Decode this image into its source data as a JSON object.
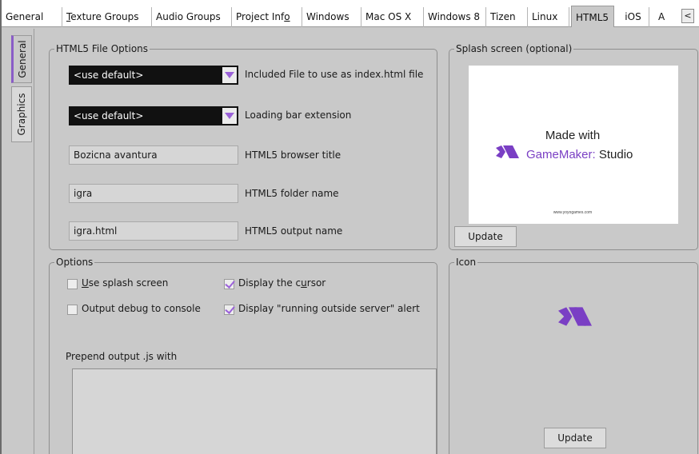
{
  "tabs": [
    {
      "pre": "",
      "ul": "",
      "label": "General"
    },
    {
      "pre": "",
      "ul": "T",
      "label": "exture Groups"
    },
    {
      "pre": "",
      "ul": "",
      "label": "Audio Groups"
    },
    {
      "pre": "Project Inf",
      "ul": "o",
      "label": ""
    },
    {
      "pre": "",
      "ul": "",
      "label": "Windows"
    },
    {
      "pre": "",
      "ul": "",
      "label": "Mac OS X"
    },
    {
      "pre": "",
      "ul": "",
      "label": "Windows 8"
    },
    {
      "pre": "",
      "ul": "",
      "label": "Tizen"
    },
    {
      "pre": "",
      "ul": "",
      "label": "Linux"
    },
    {
      "pre": "",
      "ul": "",
      "label": "HTML5"
    },
    {
      "pre": "",
      "ul": "",
      "label": "iOS"
    },
    {
      "pre": "",
      "ul": "",
      "label": "A"
    }
  ],
  "tab_scroll_glyph": "<",
  "side_tabs": [
    "General",
    "Graphics"
  ],
  "html5_options": {
    "legend": "HTML5 File Options",
    "index_dropdown_value": "<use default>",
    "index_label": "Included File to use as index.html file",
    "loadingbar_dropdown_value": "<use default>",
    "loadingbar_label": "Loading bar extension",
    "browser_title_value": "Bozicna avantura",
    "browser_title_label": "HTML5 browser title",
    "folder_name_value": "igra",
    "folder_name_label": "HTML5 folder name",
    "output_name_value": "igra.html",
    "output_name_label": "HTML5 output name"
  },
  "splash": {
    "legend": "Splash screen (optional)",
    "made_with": "Made with",
    "brand": "GameMaker: Studio",
    "url": "www.yoyogames.com",
    "update_label": "Update"
  },
  "options": {
    "legend": "Options",
    "use_splash": {
      "ul": "U",
      "label": "se splash screen",
      "checked": false
    },
    "debug_console": {
      "label": "Output debug to console",
      "checked": false
    },
    "display_cursor": {
      "pre": "Display the c",
      "ul": "u",
      "label": "rsor",
      "checked": true
    },
    "server_alert": {
      "label": "Display \"running outside server\" alert",
      "checked": true
    },
    "prepend_label": "Prepend output .js with"
  },
  "icon": {
    "legend": "Icon",
    "update_label": "Update"
  },
  "colors": {
    "accent": "#9b62d9",
    "panel": "#c9c9c9",
    "dropdown_bg": "#111111"
  }
}
